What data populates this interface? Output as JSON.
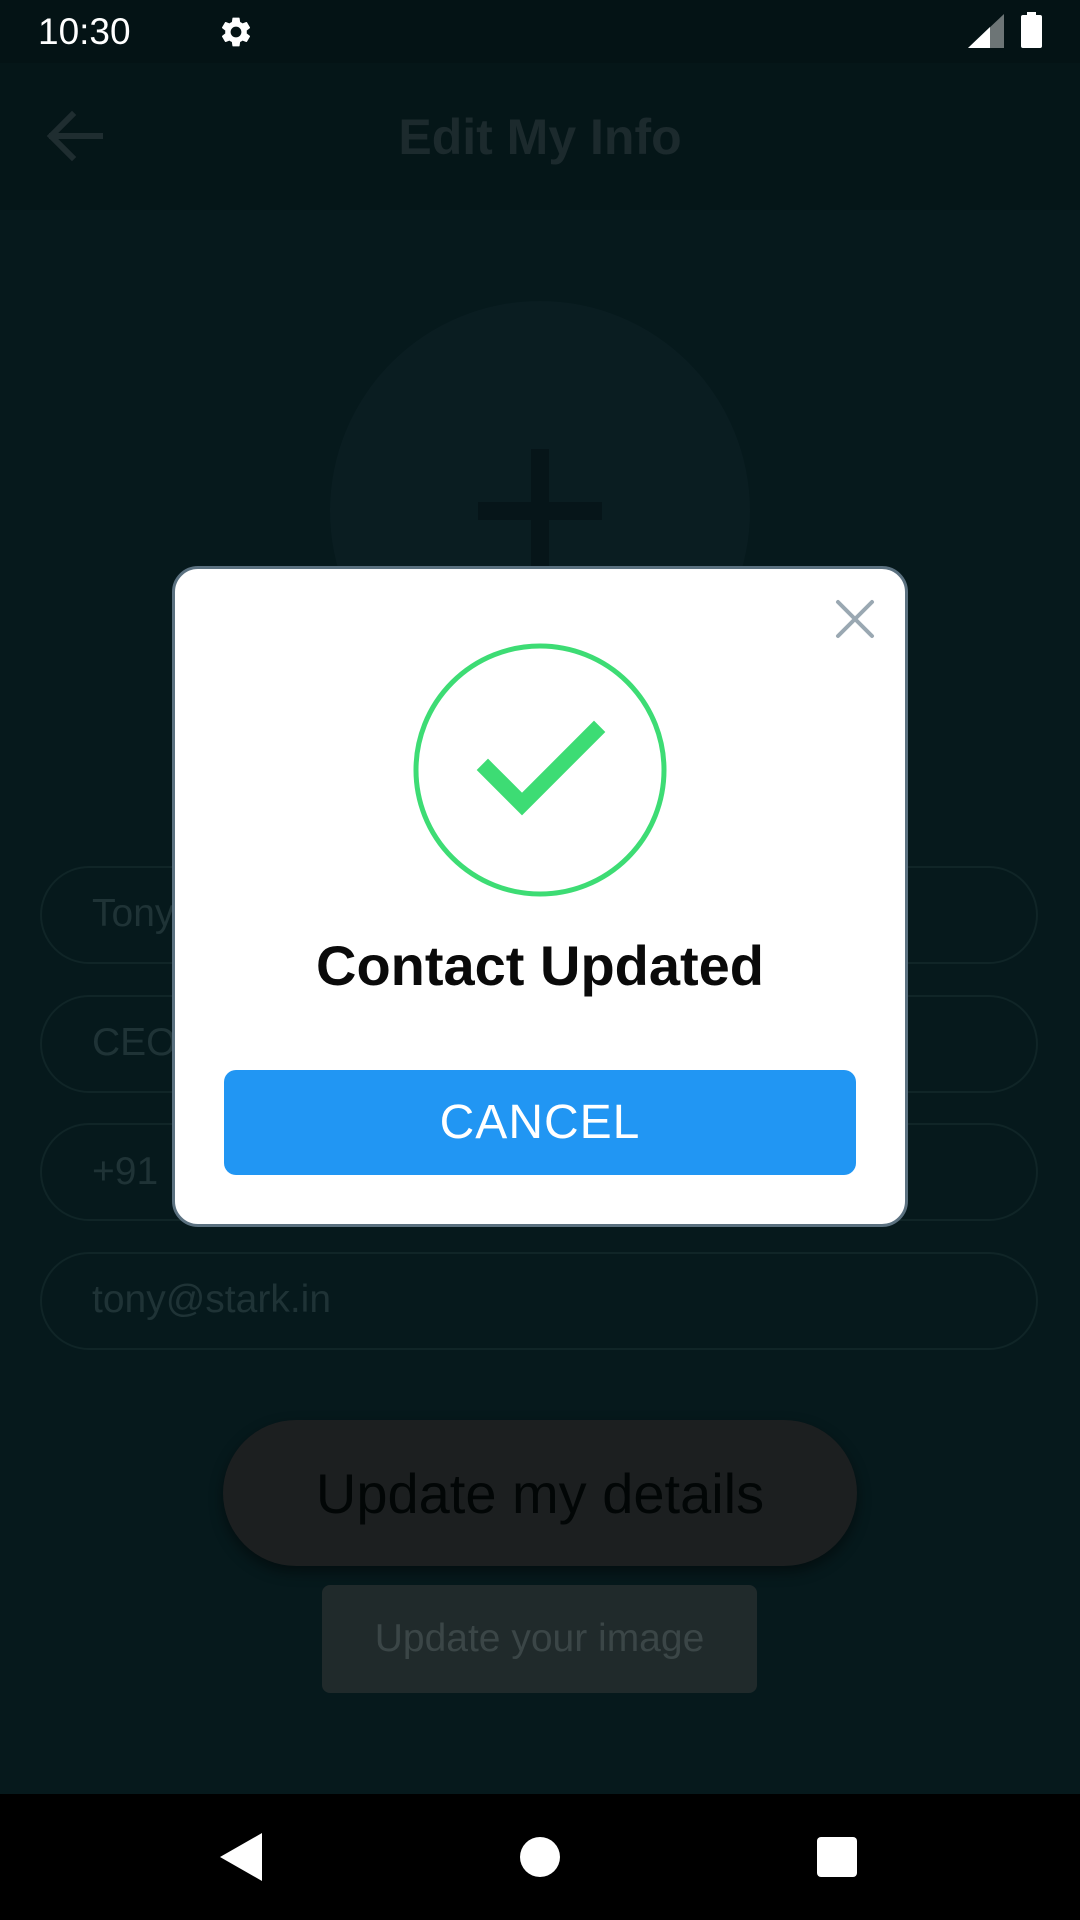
{
  "status_bar": {
    "time": "10:30"
  },
  "app_bar": {
    "title": "Edit My Info"
  },
  "form": {
    "name_value": "Tony",
    "title_value": "CEO",
    "phone_value": "+91",
    "email_value": "tony@stark.in"
  },
  "buttons": {
    "update_details": "Update my details",
    "update_image": "Update your image"
  },
  "dialog": {
    "title": "Contact Updated",
    "cancel_label": "CANCEL"
  },
  "colors": {
    "accent": "#2196f3",
    "success": "#3ddc74",
    "dialog_border": "#5b7180",
    "background": "#06191c"
  },
  "icons": {
    "status": [
      "gear-icon",
      "signal-icon",
      "battery-icon"
    ],
    "dialog": [
      "close-icon",
      "check-circle-icon"
    ],
    "nav": [
      "nav-back-icon",
      "nav-home-icon",
      "nav-recents-icon"
    ]
  }
}
